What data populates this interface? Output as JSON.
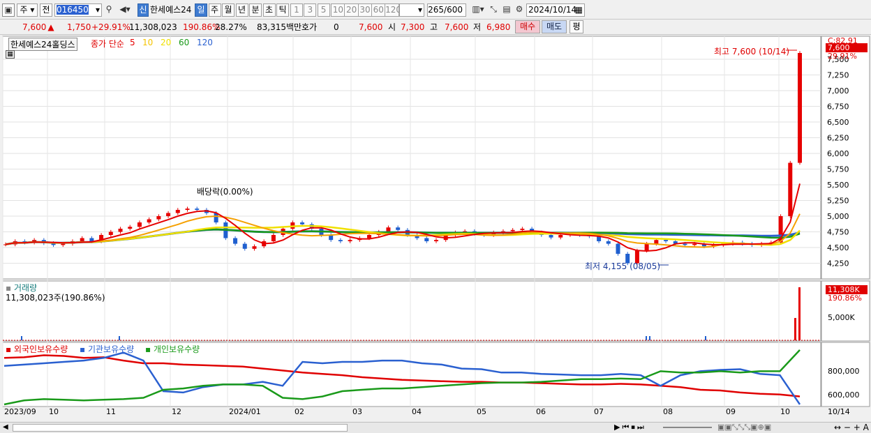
{
  "toolbar": {
    "stock_type": "주",
    "prev_label": "전",
    "code": "016450",
    "sin_badge": "신",
    "company": "한세예스24",
    "periods": [
      "일",
      "주",
      "월",
      "년",
      "분",
      "초",
      "틱"
    ],
    "selected_period": "일",
    "intervals": [
      "1",
      "3",
      "5",
      "10",
      "20",
      "30",
      "60",
      "120"
    ],
    "count": "265",
    "count_total": "/600",
    "date": "2024/10/14",
    "icons": [
      "window-icon",
      "search-icon",
      "speaker-icon",
      "chart-style-icon",
      "tools-icon",
      "save-icon",
      "gear-icon",
      "calendar-icon"
    ]
  },
  "quote": {
    "price": "7,600",
    "arrow": "▲",
    "change": "1,750",
    "change_pct": "+29.91%",
    "volume": "11,308,023",
    "vol_ratio": "190.86%",
    "turnover": "28.27%",
    "amount": "83,315백만",
    "hoga_label": "호가",
    "hoga_value": "0",
    "hoga_price": "7,600",
    "open_label": "시",
    "open": "7,300",
    "high_label": "고",
    "high": "7,600",
    "low_label": "저",
    "low": "6,980",
    "buy": "매수",
    "sell": "매도",
    "avg": "평"
  },
  "legend": {
    "name": "한세예스24홀딩스",
    "ma_title": "종가 단순",
    "ma": [
      {
        "label": "5",
        "color": "#e60000"
      },
      {
        "label": "10",
        "color": "#f5c400"
      },
      {
        "label": "20",
        "color": "#f0e000"
      },
      {
        "label": "60",
        "color": "#1a9a1a"
      },
      {
        "label": "120",
        "color": "#2a60d0"
      }
    ]
  },
  "annotations": {
    "high": "최고 7,600 (10/14)",
    "low": "최저 4,155 (08/05)",
    "dividend": "배당락(0.00%)",
    "cur_badge": "7,600",
    "c_label": "C:82.91",
    "pct_label": "29.91%"
  },
  "volume_panel": {
    "title": "거래량",
    "value": "11,308,023주(190.86%)",
    "badge": "11,308K",
    "pct": "190.86%",
    "tick": "5,000K"
  },
  "holdings_panel": {
    "series": [
      {
        "name": "외국인보유수량",
        "color": "#e00000"
      },
      {
        "name": "기관보유수량",
        "color": "#2a60d0"
      },
      {
        "name": "개인보유수량",
        "color": "#1a9a1a"
      }
    ],
    "ticks": [
      "800,000",
      "600,000"
    ]
  },
  "colors": {
    "up": "#e60000",
    "down": "#1f5fcf",
    "ma5": "#e60000",
    "ma10": "#f5a000",
    "ma20": "#f0e000",
    "ma60": "#1a9a1a",
    "ma120": "#2a60d0"
  },
  "chart_data": {
    "type": "candlestick",
    "title": "한세예스24홀딩스",
    "y_ticks": [
      "7,500",
      "7,250",
      "7,000",
      "6,750",
      "6,500",
      "6,250",
      "6,000",
      "5,750",
      "5,500",
      "5,250",
      "5,000",
      "4,750",
      "4,500",
      "4,250"
    ],
    "ylim": [
      4000,
      7800
    ],
    "x_labels": [
      "2023/09",
      "10",
      "11",
      "12",
      "2024/01",
      "02",
      "03",
      "04",
      "05",
      "06",
      "07",
      "08",
      "09",
      "10",
      "10/14"
    ],
    "close": [
      4550,
      4600,
      4580,
      4620,
      4570,
      4540,
      4560,
      4600,
      4650,
      4600,
      4700,
      4750,
      4800,
      4830,
      4900,
      4950,
      5000,
      5050,
      5100,
      5120,
      5100,
      5050,
      4900,
      4650,
      4560,
      4480,
      4520,
      4600,
      4700,
      4800,
      4900,
      4870,
      4800,
      4700,
      4620,
      4600,
      4620,
      4650,
      4700,
      4750,
      4820,
      4780,
      4700,
      4650,
      4600,
      4620,
      4700,
      4740,
      4760,
      4720,
      4700,
      4740,
      4760,
      4780,
      4800,
      4740,
      4700,
      4660,
      4700,
      4720,
      4700,
      4680,
      4600,
      4560,
      4400,
      4250,
      4450,
      4560,
      4620,
      4600,
      4560,
      4540,
      4560,
      4520,
      4540,
      4560,
      4580,
      4560,
      4540,
      4560,
      4580,
      5000,
      5850,
      7600
    ],
    "volume_spikes": [
      {
        "date": "2024/10/11",
        "rel": 0.42
      },
      {
        "date": "2024/10/14",
        "rel": 1.0
      }
    ],
    "volume_axis": "5,000K",
    "holdings": {
      "외국인보유수량": [
        900000,
        905000,
        920000,
        915000,
        900000,
        905000,
        880000,
        860000,
        860000,
        850000,
        845000,
        840000,
        835000,
        820000,
        805000,
        790000,
        780000,
        770000,
        755000,
        745000,
        735000,
        730000,
        725000,
        720000,
        720000,
        715000,
        715000,
        710000,
        705000,
        700000,
        700000,
        705000,
        700000,
        690000,
        680000,
        660000,
        655000,
        640000,
        630000,
        625000,
        610000
      ],
      "기관보유수량": [
        840000,
        850000,
        860000,
        870000,
        880000,
        900000,
        940000,
        880000,
        650000,
        640000,
        680000,
        700000,
        700000,
        720000,
        690000,
        870000,
        860000,
        870000,
        870000,
        880000,
        880000,
        860000,
        850000,
        820000,
        815000,
        790000,
        790000,
        780000,
        775000,
        770000,
        770000,
        780000,
        770000,
        690000,
        770000,
        800000,
        810000,
        815000,
        780000,
        770000,
        550000
      ],
      "개인보유수량": [
        550000,
        580000,
        590000,
        585000,
        580000,
        585000,
        590000,
        600000,
        660000,
        670000,
        690000,
        700000,
        700000,
        690000,
        600000,
        590000,
        610000,
        650000,
        660000,
        670000,
        670000,
        680000,
        690000,
        700000,
        710000,
        715000,
        715000,
        720000,
        730000,
        740000,
        740000,
        745000,
        740000,
        800000,
        790000,
        790000,
        800000,
        790000,
        800000,
        800000,
        960000
      ]
    }
  }
}
